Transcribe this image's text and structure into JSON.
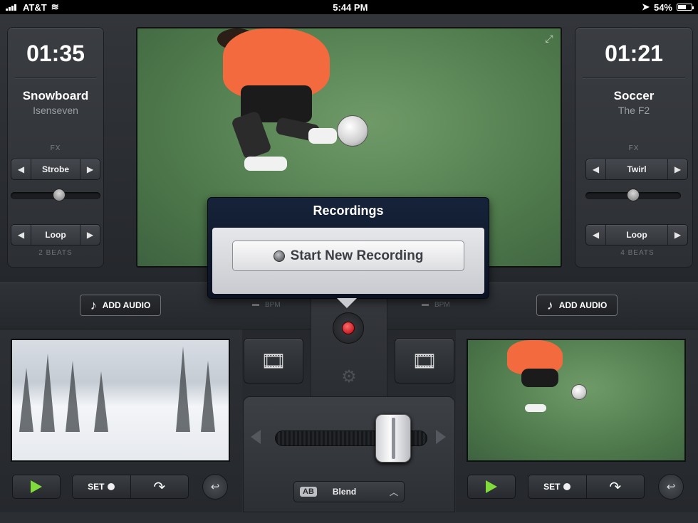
{
  "status_bar": {
    "carrier": "AT&T",
    "time": "5:44 PM",
    "battery": "54%"
  },
  "left_deck": {
    "time": "01:35",
    "title": "Snowboard",
    "artist": "Isenseven",
    "fx_label": "FX",
    "fx_value": "Strobe",
    "fx_level": 0.55,
    "loop_value": "Loop",
    "beats": "2 BEATS",
    "add_audio_label": "ADD AUDIO",
    "bpm_label": "BPM",
    "set_label": "SET"
  },
  "right_deck": {
    "time": "01:21",
    "title": "Soccer",
    "artist": "The F2",
    "fx_label": "FX",
    "fx_value": "Twirl",
    "fx_level": 0.5,
    "loop_value": "Loop",
    "beats": "4 BEATS",
    "add_audio_label": "ADD AUDIO",
    "bpm_label": "BPM",
    "set_label": "SET"
  },
  "recordings": {
    "title": "Recordings",
    "start_label": "Start New Recording"
  },
  "mixer": {
    "blend_badge": "AB",
    "blend_label": "Blend",
    "crossfader_position": 0.86
  },
  "colors": {
    "record_red": "#d0121b",
    "play_green": "#7fdc3a",
    "popover_navy": "#0b1222"
  }
}
